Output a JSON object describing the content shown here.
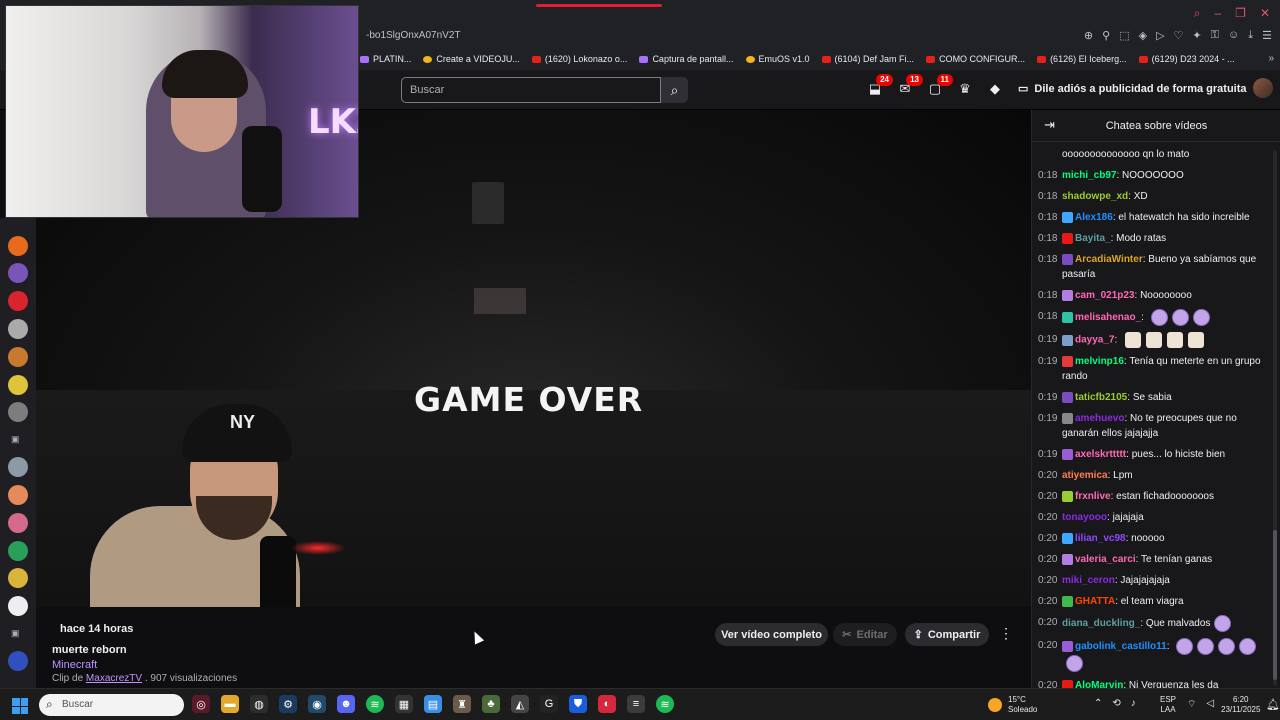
{
  "browser": {
    "url": "-bo1SlgOnxA07nV2T",
    "bookmarks": [
      "PLATIN...",
      "Create a VIDEOJU...",
      "(1620) Lokonazo o...",
      "Captura de pantall...",
      "EmuOS v1.0",
      "(6104) Def Jam Fi...",
      "COMO CONFIGUR...",
      "(6126) El Iceberg...",
      "(6129) D23 2024 - ..."
    ]
  },
  "header": {
    "search_placeholder": "Buscar",
    "badges": {
      "notifications_a": "24",
      "notifications_b": "13",
      "notifications_c": "11"
    },
    "promo": "Dile adiós a publicidad de forma gratuita"
  },
  "video": {
    "overlay_text": "GAME OVER"
  },
  "clip": {
    "posted": "hace 14 horas",
    "title": "muerte reborn",
    "game": "Minecraft",
    "clip_prefix": "Clip de",
    "channel": "MaxacrezTV",
    "views": ". 907 visualizaciones",
    "full_video_label": "Ver vídeo completo",
    "edit_label": "Editar",
    "share_label": "Compartir"
  },
  "chat": {
    "title": "Chatea sobre vídeos",
    "messages": [
      {
        "time": "",
        "user": "",
        "color": "#efeff1",
        "text": "oooooooooooooo qn lo mato",
        "badge": ""
      },
      {
        "time": "0:18",
        "user": "michi_cb97",
        "color": "#00ff7f",
        "text": "NOOOOOOO",
        "badge": ""
      },
      {
        "time": "0:18",
        "user": "shadowpe_xd",
        "color": "#9acd32",
        "text": "XD",
        "badge": ""
      },
      {
        "time": "0:18",
        "user": "Alex186",
        "color": "#1e90ff",
        "text": "el hatewatch ha sido increible",
        "badge": "#3fa7ff"
      },
      {
        "time": "0:18",
        "user": "Bayita_",
        "color": "#5f9ea0",
        "text": "Modo ratas",
        "badge": "#e91916"
      },
      {
        "time": "0:18",
        "user": "ArcadiaWinter",
        "color": "#daa520",
        "text": "Bueno ya sabíamos que pasaría",
        "badge": "#7a4cc2"
      },
      {
        "time": "0:18",
        "user": "cam_021p23",
        "color": "#ff69b4",
        "text": "Noooooooo",
        "badge": "#b17ee3"
      },
      {
        "time": "0:18",
        "user": "melisahenao_",
        "color": "#ff69b4",
        "text": "",
        "badge": "#2fc3a5",
        "emotes": 3
      },
      {
        "time": "0:19",
        "user": "dayya_7",
        "color": "#ff69b4",
        "text": "",
        "badge": "#7b9fc8",
        "emotes2": 4
      },
      {
        "time": "0:19",
        "user": "melvinp16",
        "color": "#00ff7f",
        "text": "Tenía qu meterte en un grupo rando",
        "badge": "#e53a3a"
      },
      {
        "time": "0:19",
        "user": "taticfb2105",
        "color": "#9acd32",
        "text": "Se sabia",
        "badge": "#7a4cc2"
      },
      {
        "time": "0:19",
        "user": "amehuevo",
        "color": "#8a2be2",
        "text": "No te preocupes que no ganarán ellos jajajajja",
        "badge": "#888888"
      },
      {
        "time": "0:19",
        "user": "axelskrttttt",
        "color": "#ff69b4",
        "text": "pues... lo hiciste bien",
        "badge": "#9a5dd6"
      },
      {
        "time": "0:20",
        "user": "atiyemica",
        "color": "#ff7f50",
        "text": "Lpm",
        "badge": ""
      },
      {
        "time": "0:20",
        "user": "frxnlive",
        "color": "#ff69b4",
        "text": "estan fichadooooooos",
        "badge": "#9acd32"
      },
      {
        "time": "0:20",
        "user": "tonayooo",
        "color": "#8a2be2",
        "text": "jajajaja",
        "badge": ""
      },
      {
        "time": "0:20",
        "user": "lilian_vc98",
        "color": "#9146ff",
        "text": "nooooo",
        "badge": "#3fa7ff"
      },
      {
        "time": "0:20",
        "user": "valeria_carci",
        "color": "#ff69b4",
        "text": "Te tenían ganas",
        "badge": "#b17ee3"
      },
      {
        "time": "0:20",
        "user": "miki_ceron",
        "color": "#8a2be2",
        "text": "Jajajajajaja",
        "badge": ""
      },
      {
        "time": "0:20",
        "user": "GHATTA",
        "color": "#ff4500",
        "text": "el team viagra",
        "badge": "#3dba4e"
      },
      {
        "time": "0:20",
        "user": "diana_duckling_",
        "color": "#5f9ea0",
        "text": "Que malvados",
        "badge": "",
        "emotes": 1
      },
      {
        "time": "0:20",
        "user": "gabolink_castillo11",
        "color": "#1e90ff",
        "text": "",
        "badge": "#9a5dd6",
        "emotes": 5
      },
      {
        "time": "0:20",
        "user": "AloMarvin",
        "color": "#00ff7f",
        "text": "Ni Verguenza les da",
        "badge": "#e91916"
      }
    ]
  },
  "taskbar": {
    "search_placeholder": "Buscar",
    "temperature": "15°C",
    "weather": "Soleado",
    "lang_top": "ESP",
    "lang_bottom": "LAA",
    "time": "6:20",
    "date": "23/11/2025"
  },
  "icons": [
    "search-icon",
    "bell-icon",
    "inbox-icon",
    "chat-bubble-icon",
    "crown-icon",
    "gem-icon",
    "tv-icon",
    "collapse-icon",
    "share-icon",
    "scissors-icon",
    "kebab-icon",
    "windows-start-icon",
    "wifi-icon",
    "volume-icon"
  ]
}
